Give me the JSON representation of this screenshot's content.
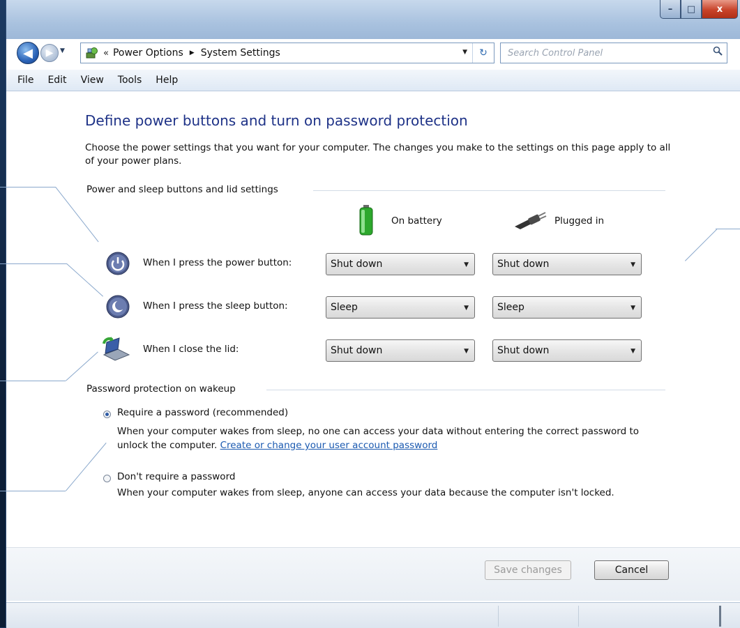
{
  "window": {
    "controls": {
      "minimize": "–",
      "maximize": "□",
      "close": "x"
    }
  },
  "nav": {
    "back_glyph": "◀",
    "forward_glyph": "▶",
    "history_glyph": "▼",
    "address_prefix": "«",
    "crumbs": [
      "Power Options",
      "System Settings"
    ],
    "crumb_separator": "▶",
    "dropdown_glyph": "▼",
    "refresh_glyph": "↻",
    "search_placeholder": "Search Control Panel"
  },
  "menu": [
    "File",
    "Edit",
    "View",
    "Tools",
    "Help"
  ],
  "page": {
    "title": "Define power buttons and turn on password protection",
    "description": "Choose the power settings that you want for your computer. The changes you make to the settings on this page apply to all of your power plans."
  },
  "power_group": {
    "label": "Power and sleep buttons and lid settings",
    "col_battery": "On battery",
    "col_plugged": "Plugged in",
    "rows": [
      {
        "label": "When I press the power button:",
        "battery": "Shut down",
        "plugged": "Shut down"
      },
      {
        "label": "When I press the sleep button:",
        "battery": "Sleep",
        "plugged": "Sleep"
      },
      {
        "label": "When I close the lid:",
        "battery": "Shut down",
        "plugged": "Shut down"
      }
    ]
  },
  "password_group": {
    "label": "Password protection on wakeup",
    "require": {
      "label": "Require a password (recommended)",
      "desc": "When your computer wakes from sleep, no one can access your data without entering the correct password to unlock the computer.",
      "link": "Create or change your user account password",
      "selected": true
    },
    "no_require": {
      "label": "Don't require a password",
      "desc": "When your computer wakes from sleep, anyone can access your data because the computer isn't locked.",
      "selected": false
    }
  },
  "buttons": {
    "save": "Save changes",
    "cancel": "Cancel"
  },
  "colors": {
    "title": "#1e3287",
    "link": "#1a59b0",
    "close": "#c8432a"
  }
}
